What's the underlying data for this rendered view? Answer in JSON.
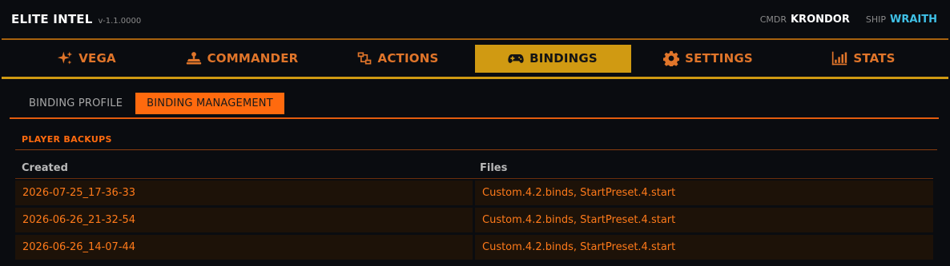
{
  "header": {
    "title": "ELITE INTEL",
    "version": "v-1.1.0000",
    "cmdr_label": "CMDR",
    "cmdr_name": "KRONDOR",
    "ship_label": "SHIP",
    "ship_name": "WRAITH"
  },
  "nav": {
    "tabs": [
      {
        "label": "VEGA",
        "icon": "sparkle-icon"
      },
      {
        "label": "COMMANDER",
        "icon": "commander-icon"
      },
      {
        "label": "ACTIONS",
        "icon": "actions-icon"
      },
      {
        "label": "BINDINGS",
        "icon": "gamepad-icon",
        "active": true
      },
      {
        "label": "SETTINGS",
        "icon": "gear-icon"
      },
      {
        "label": "STATS",
        "icon": "bar-chart-icon"
      }
    ]
  },
  "subtabs": [
    {
      "label": "BINDING PROFILE"
    },
    {
      "label": "BINDING MANAGEMENT",
      "active": true
    }
  ],
  "section": {
    "title": "PLAYER BACKUPS"
  },
  "table": {
    "columns": [
      "Created",
      "Files"
    ],
    "rows": [
      {
        "created": "2026-07-25_17-36-33",
        "files": "Custom.4.2.binds, StartPreset.4.start"
      },
      {
        "created": "2026-06-26_21-32-54",
        "files": "Custom.4.2.binds, StartPreset.4.start"
      },
      {
        "created": "2026-06-26_14-07-44",
        "files": "Custom.4.2.binds, StartPreset.4.start"
      }
    ]
  },
  "colors": {
    "accent_orange": "#ff6a0e",
    "active_tab_gold": "#d09a12",
    "ship_cyan": "#3fc0e6"
  }
}
